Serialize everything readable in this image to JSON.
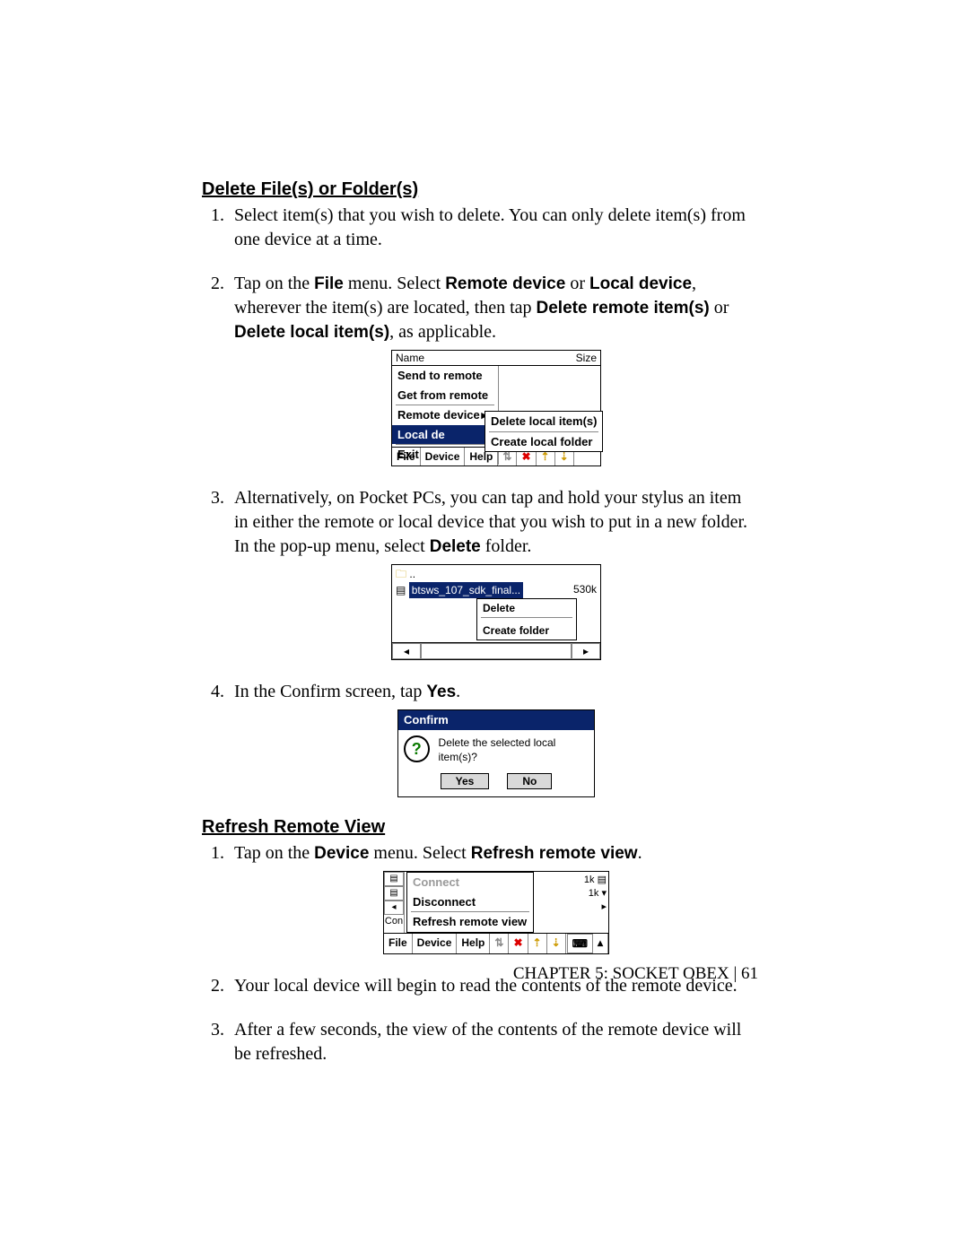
{
  "section1": {
    "heading": "Delete File(s) or Folder(s)",
    "step1": "Select item(s) that you wish to delete. You can only delete item(s) from one device at a time.",
    "step2_a": "Tap on the ",
    "step2_file": "File",
    "step2_b": " menu. Select ",
    "step2_remote": "Remote device",
    "step2_c": " or ",
    "step2_local": "Local device",
    "step2_d": ", wherever the item(s) are located, then tap ",
    "step2_dri": "Delete remote item(s)",
    "step2_e": " or ",
    "step2_dli": "Delete local item(s)",
    "step2_f": ", as applicable.",
    "step3_a": "Alternatively, on Pocket PCs, you can tap and hold your stylus an item in either the remote or local device that you wish to put in a new folder. In the pop-up menu, select ",
    "step3_delete": "Delete",
    "step3_b": " folder.",
    "step4_a": "In the Confirm screen, tap ",
    "step4_yes": "Yes",
    "step4_b": "."
  },
  "section2": {
    "heading": "Refresh Remote View",
    "step1_a": "Tap on the ",
    "step1_device": "Device",
    "step1_b": " menu. Select ",
    "step1_refresh": "Refresh remote view",
    "step1_c": ".",
    "step2": "Your local device will begin to read the contents of the remote device.",
    "step3": "After a few seconds, the view of the contents of the remote device will be refreshed."
  },
  "fig1": {
    "hdr_name": "Name",
    "hdr_size": "Size",
    "m_send": "Send to remote",
    "m_get": "Get from remote",
    "m_remote": "Remote device",
    "m_local": "Local de",
    "m_exit": "Exit",
    "sub_delete": "Delete local item(s)",
    "sub_create": "Create local folder",
    "bar_file": "File",
    "bar_device": "Device",
    "bar_help": "Help"
  },
  "fig2": {
    "up": "..",
    "filename": "btsws_107_sdk_final...",
    "size": "530k",
    "ctx_delete": "Delete",
    "ctx_create": "Create folder"
  },
  "fig3": {
    "title": "Confirm",
    "msg": "Delete the selected local item(s)?",
    "yes": "Yes",
    "no": "No",
    "qmark": "?"
  },
  "fig4": {
    "con": "Con",
    "m_connect": "Connect",
    "m_disconnect": "Disconnect",
    "m_refresh": "Refresh remote view",
    "k1": "1k",
    "k2": "1k",
    "bar_file": "File",
    "bar_device": "Device",
    "bar_help": "Help"
  },
  "footer": "CHAPTER 5: SOCKET OBEX | 61"
}
